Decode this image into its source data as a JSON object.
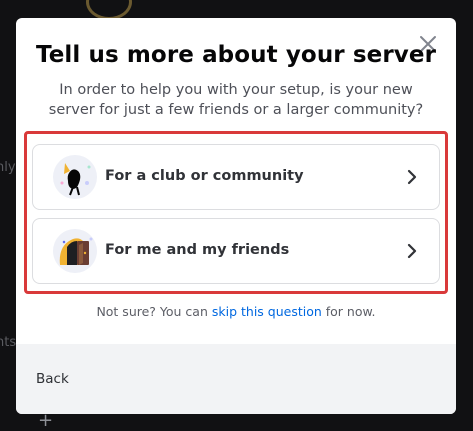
{
  "background": {
    "fragment_left": "nly",
    "fragment_left2": "nts"
  },
  "modal": {
    "title": "Tell us more about your server",
    "subtitle": "In order to help you with your setup, is your new server for just a few friends or a larger community?",
    "close_icon": "close-icon",
    "options": [
      {
        "label": "For a club or community",
        "icon": "club-community-illustration"
      },
      {
        "label": "For me and my friends",
        "icon": "friends-illustration"
      }
    ],
    "not_sure_prefix": "Not sure? You can ",
    "skip_link": "skip this question",
    "not_sure_suffix": " for now.",
    "back_label": "Back"
  },
  "colors": {
    "highlight_border": "#d9393a",
    "link": "#0068e0",
    "footer_bg": "#f2f3f5"
  }
}
